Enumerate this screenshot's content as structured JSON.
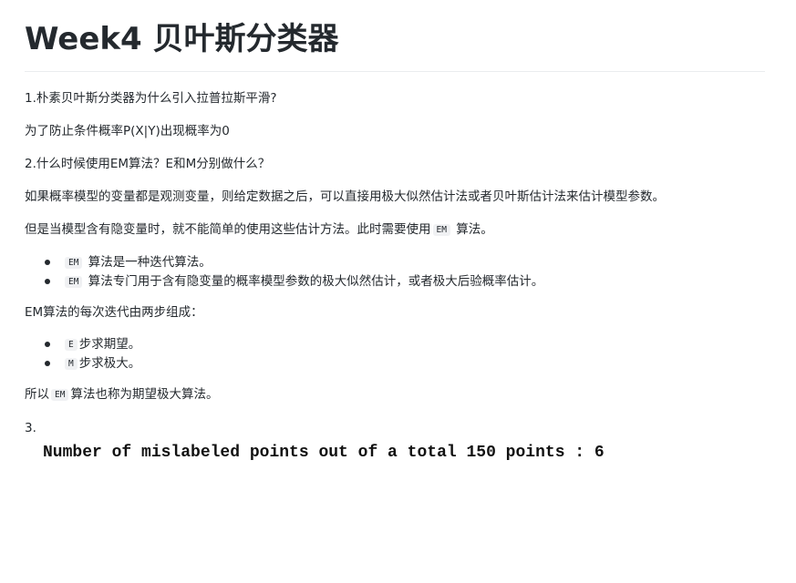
{
  "title": "Week4 贝叶斯分类器",
  "q1": "1.朴素贝叶斯分类器为什么引入拉普拉斯平滑?",
  "a1": "为了防止条件概率P(X|Y)出现概率为0",
  "q2": "2.什么时候使用EM算法？E和M分别做什么？",
  "p1": "如果概率模型的变量都是观测变量，则给定数据之后，可以直接用极大似然估计法或者贝叶斯估计法来估计模型参数。",
  "p2": {
    "before": "但是当模型含有隐变量时，就不能简单的使用这些估计方法。此时需要使用",
    "code": "EM",
    "after": " 算法。"
  },
  "list1": [
    {
      "code": "EM",
      "text": " 算法是一种迭代算法。"
    },
    {
      "code": "EM",
      "text": " 算法专门用于含有隐变量的概率模型参数的极大似然估计，或者极大后验概率估计。"
    }
  ],
  "p3": "EM算法的每次迭代由两步组成：",
  "list2": [
    {
      "code": "E",
      "text": "步求期望。"
    },
    {
      "code": "M",
      "text": "步求极大。"
    }
  ],
  "p4": {
    "before": "所以",
    "code": "EM",
    "after": "算法也称为期望极大算法。"
  },
  "q3": "3.",
  "output": "Number of mislabeled points out of a total 150 points : 6"
}
